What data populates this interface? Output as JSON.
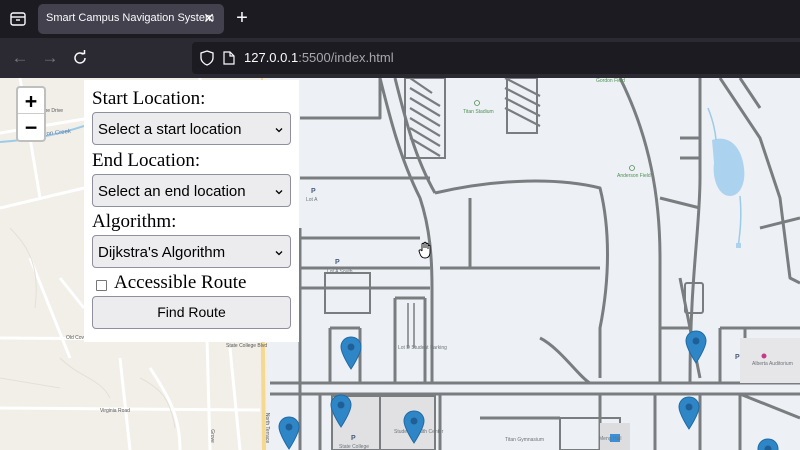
{
  "browser": {
    "tab_title": "Smart Campus Navigation System",
    "url_host": "127.0.0.1",
    "url_rest": ":5500/index.html"
  },
  "controls": {
    "start_label": "Start Location:",
    "start_value": "Select a start location",
    "end_label": "End Location:",
    "end_value": "Select an end location",
    "algorithm_label": "Algorithm:",
    "algorithm_value": "Dijkstra's Algorithm",
    "accessible_label": "Accessible Route",
    "accessible_checked": false,
    "find_button": "Find Route"
  },
  "zoom": {
    "in": "+",
    "out": "−"
  },
  "map_labels": {
    "gordon_field": "Gordon Field",
    "titan_stadium": "Titan Stadium",
    "anderson_field": "Anderson Field",
    "lot_a": "Lot A",
    "lot_a_south": "Lot A South",
    "lot_d": "Lot D Student Parking",
    "fullerton_creek": "Fullerton Creek",
    "pine_drive": "Pine Drive",
    "old_cove": "Old Cove",
    "virginia_road": "Virginia Road",
    "state_college_1": "State College Blvd",
    "state_college_2": "State College",
    "student_health": "Student Health Center",
    "titan_gym": "Titan Gymnasium",
    "meng_hall": "Meng Hall",
    "alberta_auditorium": "Alberta Auditorium",
    "grove": "Grove",
    "north_terrace": "North Terrace",
    "p": "P"
  },
  "colors": {
    "map_bg": "#f2efe9",
    "campus": "#edf1f5",
    "road": "#7a7d80",
    "water": "#abd3ef",
    "marker": "#2f86c6"
  }
}
